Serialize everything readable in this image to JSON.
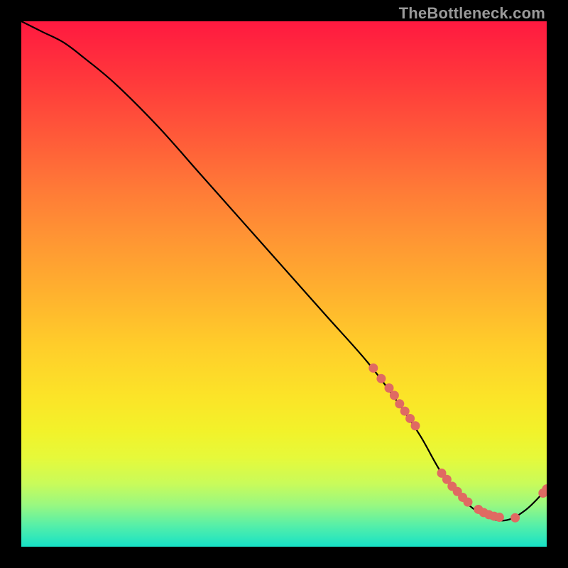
{
  "watermark": {
    "text": "TheBottleneck.com"
  },
  "chart_data": {
    "type": "line",
    "title": "",
    "xlabel": "",
    "ylabel": "",
    "xlim": [
      0,
      100
    ],
    "ylim": [
      0,
      100
    ],
    "series": [
      {
        "name": "bottleneck-curve",
        "x": [
          0,
          4,
          8,
          12,
          18,
          26,
          34,
          42,
          50,
          58,
          66,
          72,
          76,
          80,
          84,
          88,
          92,
          96,
          100
        ],
        "y": [
          100,
          98,
          96,
          93,
          88,
          80,
          71,
          62,
          53,
          44,
          35,
          27,
          21,
          14,
          9,
          6,
          5,
          7,
          11
        ]
      }
    ],
    "markers": {
      "name": "data-points",
      "color": "#e06a62",
      "x": [
        67,
        68.5,
        70,
        71,
        72,
        73,
        74,
        75,
        80,
        81,
        82,
        83,
        84,
        85,
        87,
        88,
        89,
        90,
        91,
        94,
        99.3,
        100
      ],
      "y": [
        34,
        32,
        30.2,
        28.8,
        27.2,
        25.8,
        24.4,
        23,
        14,
        12.8,
        11.5,
        10.5,
        9.4,
        8.5,
        7.1,
        6.5,
        6.1,
        5.8,
        5.6,
        5.5,
        10.2,
        11
      ]
    }
  }
}
